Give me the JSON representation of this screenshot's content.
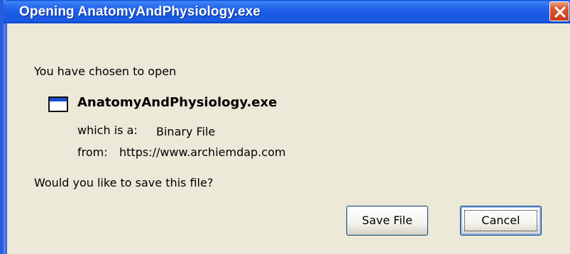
{
  "window": {
    "title": "Opening AnatomyAndPhysiology.exe",
    "close_icon": "close-icon"
  },
  "dialog": {
    "intro": "You have chosen to open",
    "file": {
      "icon": "application-window-icon",
      "name": "AnatomyAndPhysiology.exe",
      "type_label": "which is a:",
      "type_value": "Binary File",
      "from_label": "from:",
      "from_value": "https://www.archiemdap.com"
    },
    "question": "Would you like to save this file?"
  },
  "buttons": {
    "save": "Save File",
    "cancel": "Cancel"
  },
  "colors": {
    "titlebar": "#1e5fe8",
    "client": "#ece9d8",
    "close": "#d9552f"
  }
}
